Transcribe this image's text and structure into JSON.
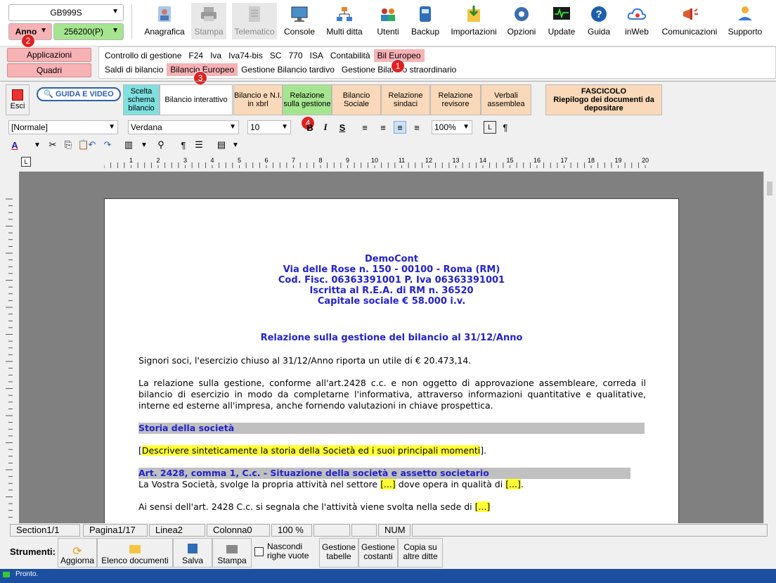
{
  "top": {
    "company_combo": "GB999S",
    "year_label": "Anno",
    "year_combo": "256200(P)",
    "toolbar": [
      {
        "label": "Anagrafica",
        "icon": "user-card-icon",
        "disabled": false
      },
      {
        "label": "Stampa",
        "icon": "printer-icon",
        "disabled": true
      },
      {
        "label": "Telematico",
        "icon": "document-icon",
        "disabled": true
      },
      {
        "label": "Console",
        "icon": "monitor-icon",
        "disabled": false
      },
      {
        "label": "Multi ditta",
        "icon": "org-chart-icon",
        "disabled": false
      },
      {
        "label": "Utenti",
        "icon": "users-icon",
        "disabled": false
      },
      {
        "label": "Backup",
        "icon": "backup-icon",
        "disabled": false
      },
      {
        "label": "Importazioni",
        "icon": "import-icon",
        "disabled": false
      },
      {
        "label": "Opzioni",
        "icon": "gear-icon",
        "disabled": false
      },
      {
        "label": "Update",
        "icon": "update-icon",
        "disabled": false
      },
      {
        "label": "Guida",
        "icon": "help-icon",
        "disabled": false
      },
      {
        "label": "inWeb",
        "icon": "cloud-icon",
        "disabled": false
      },
      {
        "label": "Comunicazioni",
        "icon": "megaphone-icon",
        "disabled": false
      },
      {
        "label": "Supporto",
        "icon": "support-icon",
        "disabled": false
      }
    ]
  },
  "nav": {
    "applicazioni": "Applicazioni",
    "quadri": "Quadri",
    "row1": [
      "Controllo di gestione",
      "F24",
      "Iva",
      "Iva74-bis",
      "SC",
      "770",
      "ISA",
      "Contabilità",
      "Bil Europeo"
    ],
    "row2": [
      "Saldi di bilancio",
      "Bilancio Europeo",
      "Gestione Bilancio tardivo",
      "Gestione Bilancio straordinario"
    ]
  },
  "badges": [
    "1",
    "2",
    "3",
    "4"
  ],
  "sections": {
    "esci": "Esci",
    "guida_video": "GUIDA E VIDEO",
    "scelta_schema": "Scelta schema bilancio",
    "bilancio_interattivo": "Bilancio interattivo",
    "bilancio_ni": "Bilancio e N.I. in xbrl",
    "relazione_gestione": "Relazione sulla gestione",
    "bilancio_sociale": "Bilancio Sociale",
    "relazione_sindaci": "Relazione sindaci",
    "relazione_revisore": "Relazione revisore",
    "verbali": "Verbali assemblea",
    "fascicolo_title": "FASCICOLO",
    "fascicolo_sub": "Riepilogo dei documenti da depositare"
  },
  "format": {
    "style": "[Normale]",
    "font": "Verdana",
    "size": "10",
    "zoom": "100%"
  },
  "ruler_numbers": [
    "1",
    "2",
    "3",
    "4",
    "5",
    "6",
    "7",
    "8",
    "9",
    "10",
    "11",
    "12",
    "13",
    "14",
    "15",
    "16",
    "17",
    "18",
    "19",
    "20"
  ],
  "doc": {
    "company": "DemoCont",
    "address": "Via delle Rose n. 150 - 00100 - Roma (RM)",
    "fiscal": "Cod. Fisc. 06363391001 P. Iva 06363391001",
    "rea": "Iscritta al R.E.A. di RM n. 36520",
    "capital": "Capitale sociale € 58.000 i.v.",
    "title": "Relazione sulla gestione del bilancio al 31/12/Anno",
    "p1": "Signori soci, l'esercizio chiuso al 31/12/Anno riporta un utile di € 20.473,14.",
    "p2": "La relazione sulla gestione, conforme all'art.2428 c.c. e non oggetto di approvazione assembleare, correda il bilancio di esercizio in modo da completarne l'informativa, attraverso informazioni quantitative e qualitative, interne ed esterne all'impresa, anche fornendo valutazioni in chiave prospettica.",
    "h1": "Storia della società",
    "p3_open": "[",
    "p3_hl": "Descrivere sinteticamente la storia della Società ed i suoi principali momenti",
    "p3_close": "].",
    "h2": "Art. 2428, comma 1, C.c. - Situazione della società e assetto societario",
    "p4_a": "La Vostra Società, svolge la propria attività nel settore ",
    "p4_hl1": "[...]",
    "p4_b": " dove opera in qualità di ",
    "p4_hl2": "[...]",
    "p4_c": ".",
    "p5_a": "Ai sensi dell'art. 2428 C.c. si segnala che l'attività viene svolta nella sede di ",
    "p5_hl": "[...]"
  },
  "status": {
    "section": "Section1/1",
    "page": "Pagina1/17",
    "line": "Linea2",
    "col": "Colonna0",
    "zoom": "100 %",
    "num": "NUM"
  },
  "bottom": {
    "strumenti": "Strumenti:",
    "aggiorna": "Aggiorna",
    "elenco": "Elenco documenti",
    "salva": "Salva",
    "stampa": "Stampa",
    "nascondi": "Nascondi righe vuote",
    "gest_tabelle": "Gestione tabelle",
    "gest_costanti": "Gestione costanti",
    "copia": "Copia su altre ditte",
    "pronto": "Pronto."
  }
}
